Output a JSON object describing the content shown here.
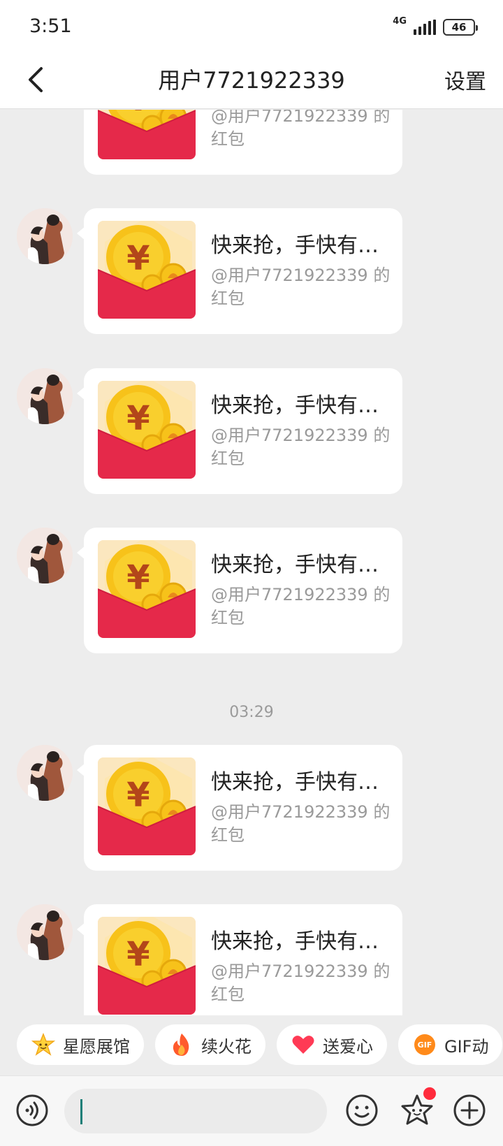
{
  "status_bar": {
    "time": "3:51",
    "network": "4G",
    "battery": "46"
  },
  "header": {
    "back_icon": "chevron-left-icon",
    "title": "用户7721922339",
    "settings_label": "设置"
  },
  "messages": [
    {
      "type": "red_packet",
      "title": "",
      "subtitle": "@用户7721922339 的红包"
    },
    {
      "type": "red_packet",
      "title": "快来抢，手快有…",
      "subtitle": "@用户7721922339 的红包"
    },
    {
      "type": "red_packet",
      "title": "快来抢，手快有…",
      "subtitle": "@用户7721922339 的红包"
    },
    {
      "type": "red_packet",
      "title": "快来抢，手快有…",
      "subtitle": "@用户7721922339 的红包"
    },
    {
      "type": "timestamp",
      "text": "03:29"
    },
    {
      "type": "red_packet",
      "title": "快来抢，手快有…",
      "subtitle": "@用户7721922339 的红包"
    },
    {
      "type": "red_packet",
      "title": "快来抢，手快有…",
      "subtitle": "@用户7721922339 的红包"
    }
  ],
  "quick_actions": [
    {
      "label": "星愿展馆",
      "icon": "star-face-icon"
    },
    {
      "label": "续火花",
      "icon": "flame-icon"
    },
    {
      "label": "送爱心",
      "icon": "heart-icon"
    },
    {
      "label": "GIF动",
      "icon": "gif-icon"
    }
  ],
  "input_bar": {
    "placeholder": "",
    "icons": [
      "voice-icon",
      "emoji-icon",
      "star-icon",
      "plus-icon"
    ]
  },
  "colors": {
    "red_packet": "#e5294a",
    "coin": "#f7c21a",
    "accent_caret": "#1a7f78",
    "badge": "#ff2b3c"
  }
}
